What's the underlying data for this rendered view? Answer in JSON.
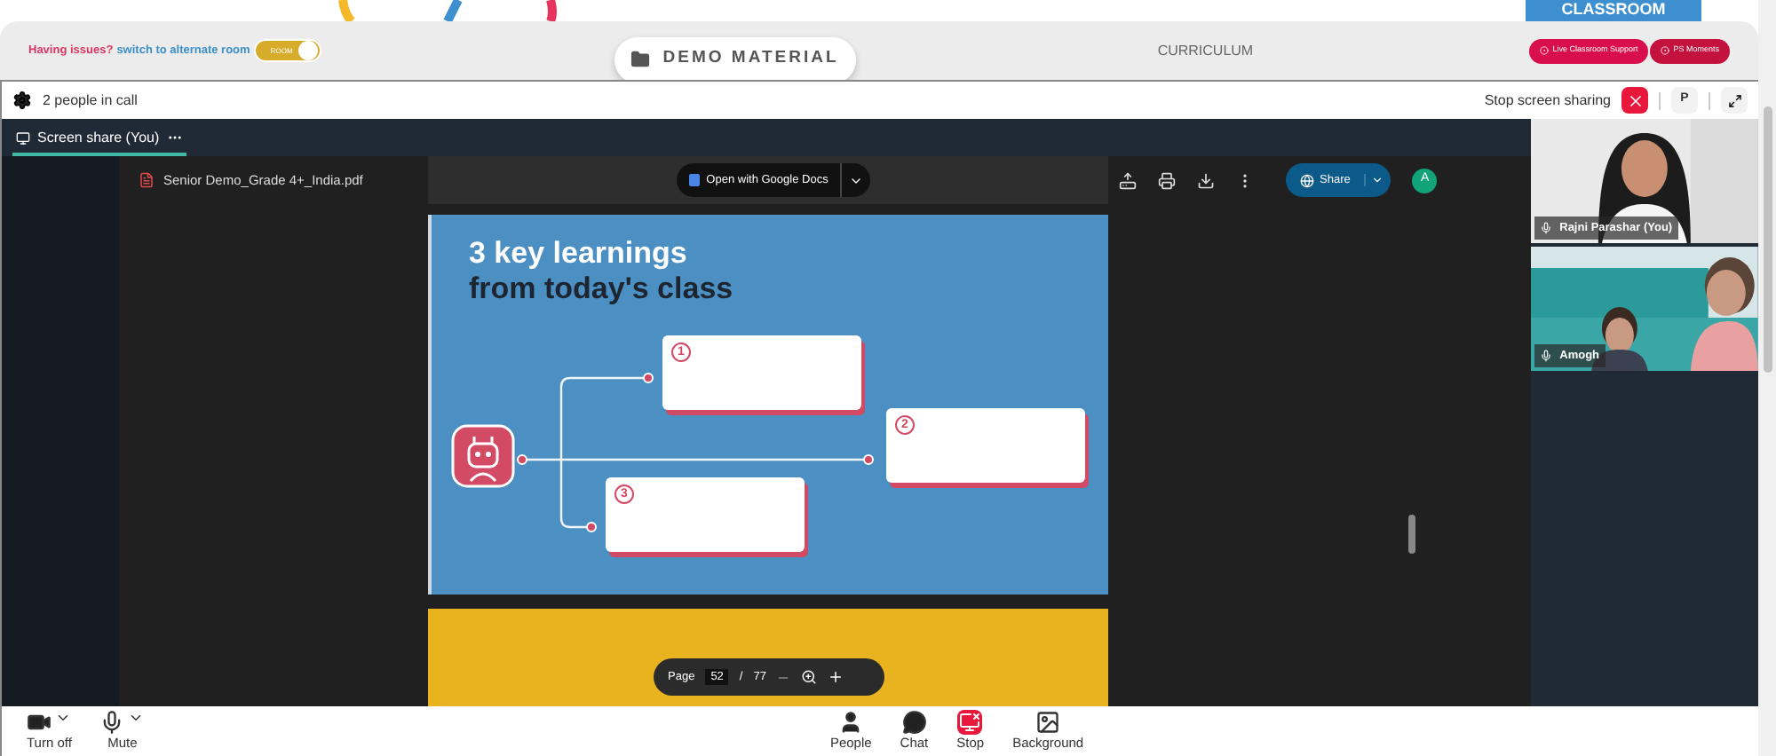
{
  "top_banner": {
    "tab": "CLASSROOM"
  },
  "header": {
    "issue_text": "Having issues?",
    "switch_link": "switch to alternate room",
    "room_toggle": {
      "label": "ROOM",
      "on": true
    },
    "demo_button": "DEMO MATERIAL",
    "curriculum": "CURRICULUM",
    "pills": [
      "Live Classroom Support",
      "PS Moments"
    ]
  },
  "call_bar": {
    "people": "2 people in call",
    "stop_label": "Stop screen sharing",
    "avatar_button": "P"
  },
  "tabs": [
    {
      "label": "Screen share (You)",
      "selected": true
    }
  ],
  "pdf": {
    "filename": "Senior Demo_Grade 4+_India.pdf",
    "open_with": "Open with Google Docs",
    "share": "Share",
    "account": "A",
    "slide": {
      "title_line1": "3 key learnings",
      "title_line2": "from today's class",
      "boxes": [
        "1",
        "2",
        "3"
      ]
    },
    "page_label": "Page",
    "page": "52",
    "separator": "/",
    "total": "77"
  },
  "participants": [
    {
      "name": "Rajni Parashar (You)"
    },
    {
      "name": "Amogh"
    }
  ],
  "controls_left": [
    {
      "kind": "camera",
      "label": "Turn off"
    },
    {
      "kind": "mic",
      "label": "Mute"
    }
  ],
  "controls_right": [
    {
      "kind": "people",
      "label": "People"
    },
    {
      "kind": "chat",
      "label": "Chat"
    },
    {
      "kind": "stop",
      "label": "Stop"
    },
    {
      "kind": "background",
      "label": "Background"
    }
  ]
}
